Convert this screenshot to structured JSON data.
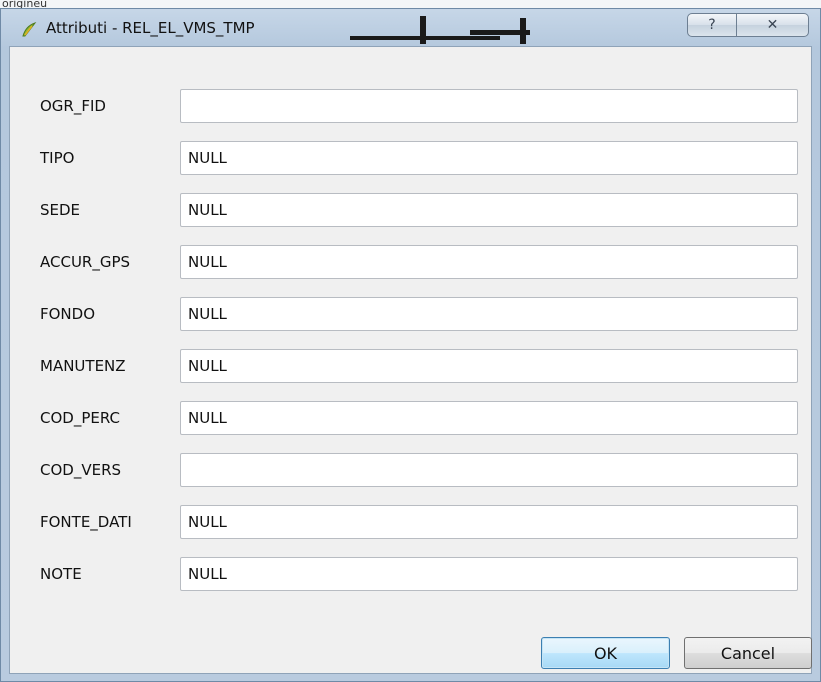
{
  "background": {
    "partial_text": "origineu"
  },
  "window": {
    "title": "Attributi - REL_EL_VMS_TMP",
    "icon": "qgis-icon",
    "help_button_glyph": "?",
    "close_button_glyph": "✕"
  },
  "fields": [
    {
      "label": "OGR_FID",
      "value": ""
    },
    {
      "label": "TIPO",
      "value": "NULL"
    },
    {
      "label": "SEDE",
      "value": "NULL"
    },
    {
      "label": "ACCUR_GPS",
      "value": "NULL"
    },
    {
      "label": "FONDO",
      "value": "NULL"
    },
    {
      "label": "MANUTENZ",
      "value": "NULL"
    },
    {
      "label": "COD_PERC",
      "value": "NULL"
    },
    {
      "label": "COD_VERS",
      "value": ""
    },
    {
      "label": "FONTE_DATI",
      "value": "NULL"
    },
    {
      "label": "NOTE",
      "value": "NULL"
    }
  ],
  "buttons": {
    "ok": "OK",
    "cancel": "Cancel"
  }
}
